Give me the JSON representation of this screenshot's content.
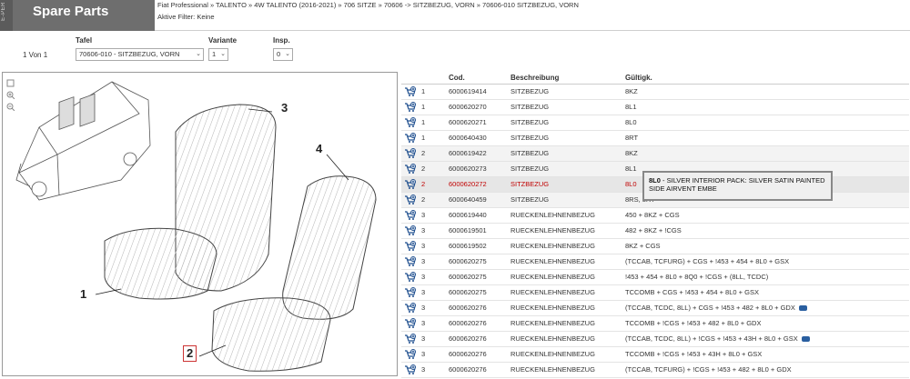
{
  "header": {
    "side_strip_text": "E-PER",
    "brand": "Spare Parts",
    "breadcrumb": "Fiat Professional » TALENTO » 4W TALENTO (2016-2021) » 706 SITZE » 70606 -> SITZBEZUG, VORN » 70606-010 SITZBEZUG, VORN",
    "filter": "Aktive Filter: Keine"
  },
  "controls": {
    "page_count": "1 Von 1",
    "tafel_label": "Tafel",
    "tafel_value": "70606-010 - SITZBEZUG, VORN",
    "variante_label": "Variante",
    "variante_value": "1",
    "insp_label": "Insp.",
    "insp_value": "0"
  },
  "diagram": {
    "callouts": [
      "1",
      "2",
      "3",
      "4"
    ],
    "selected_callout": "2",
    "tool_icons": [
      "frame-icon",
      "zoom-in-icon",
      "zoom-out-icon"
    ]
  },
  "table": {
    "columns": [
      "",
      "",
      "Cod.",
      "Beschreibung",
      "Gültigk."
    ],
    "rows": [
      {
        "qty": "1",
        "code": "6000619414",
        "desc": "SITZBEZUG",
        "valid": "8KZ",
        "note": false
      },
      {
        "qty": "1",
        "code": "6000620270",
        "desc": "SITZBEZUG",
        "valid": "8L1",
        "note": false
      },
      {
        "qty": "1",
        "code": "6000620271",
        "desc": "SITZBEZUG",
        "valid": "8L0",
        "note": false
      },
      {
        "qty": "1",
        "code": "6000640430",
        "desc": "SITZBEZUG",
        "valid": "8RT",
        "note": false
      },
      {
        "qty": "2",
        "code": "6000619422",
        "desc": "SITZBEZUG",
        "valid": "8KZ",
        "note": false
      },
      {
        "qty": "2",
        "code": "6000620273",
        "desc": "SITZBEZUG",
        "valid": "8L1",
        "note": false
      },
      {
        "qty": "2",
        "code": "6000620272",
        "desc": "SITZBEZUG",
        "valid": "8L0",
        "note": false,
        "selected": true
      },
      {
        "qty": "2",
        "code": "6000640459",
        "desc": "SITZBEZUG",
        "valid": "8RS, 8RT",
        "note": false
      },
      {
        "qty": "3",
        "code": "6000619440",
        "desc": "RUECKENLEHNENBEZUG",
        "valid": "450 + 8KZ + CGS",
        "note": false
      },
      {
        "qty": "3",
        "code": "6000619501",
        "desc": "RUECKENLEHNENBEZUG",
        "valid": "482 + 8KZ + !CGS",
        "note": false
      },
      {
        "qty": "3",
        "code": "6000619502",
        "desc": "RUECKENLEHNENBEZUG",
        "valid": "8KZ + CGS",
        "note": false
      },
      {
        "qty": "3",
        "code": "6000620275",
        "desc": "RUECKENLEHNENBEZUG",
        "valid": "(TCCAB, TCFURG) + CGS + !453 + 454 + 8L0 + GSX",
        "note": false
      },
      {
        "qty": "3",
        "code": "6000620275",
        "desc": "RUECKENLEHNENBEZUG",
        "valid": "!453 + 454 + 8L0 + 8Q0 + !CGS + (8LL, TCDC)",
        "note": false
      },
      {
        "qty": "3",
        "code": "6000620275",
        "desc": "RUECKENLEHNENBEZUG",
        "valid": "TCCOMB + CGS + !453 + 454 + 8L0 + GSX",
        "note": false
      },
      {
        "qty": "3",
        "code": "6000620276",
        "desc": "RUECKENLEHNENBEZUG",
        "valid": "(TCCAB, TCDC, 8LL) + CGS + !453 + 482 + 8L0 + GDX",
        "note": true
      },
      {
        "qty": "3",
        "code": "6000620276",
        "desc": "RUECKENLEHNENBEZUG",
        "valid": "TCCOMB + !CGS + !453 + 482 + 8L0 + GDX",
        "note": false
      },
      {
        "qty": "3",
        "code": "6000620276",
        "desc": "RUECKENLEHNENBEZUG",
        "valid": "(TCCAB, TCDC, 8LL) + !CGS + !453 + 43H + 8L0 + GSX",
        "note": true
      },
      {
        "qty": "3",
        "code": "6000620276",
        "desc": "RUECKENLEHNENBEZUG",
        "valid": "TCCOMB + !CGS + !453 + 43H + 8L0 + GSX",
        "note": false
      },
      {
        "qty": "3",
        "code": "6000620276",
        "desc": "RUECKENLEHNENBEZUG",
        "valid": "(TCCAB, TCFURG) + !CGS + !453 + 482 + 8L0 + GDX",
        "note": false
      }
    ]
  },
  "tooltip": {
    "code": "8L0",
    "text": " - SILVER INTERIOR PACK: SILVER SATIN PAINTED SIDE AIRVENT EMBE"
  },
  "colors": {
    "brand_bg": "#6e6e6e",
    "selected_text": "#c00000",
    "cart_icon": "#1f4f8f"
  }
}
